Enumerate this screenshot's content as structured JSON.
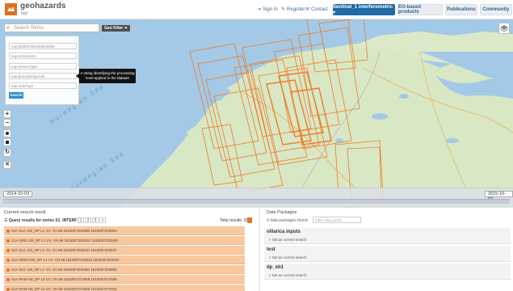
{
  "header": {
    "brand": "geohazards",
    "brand_sub": "tep",
    "sign_in": "Sign In",
    "register": "Register",
    "contact": "Contact",
    "context_button": "Sentinel_1 interferometric ▾",
    "eo_products": "EO-based products",
    "publications": "Publications",
    "community": "Community"
  },
  "search": {
    "placeholder": "Search Terms",
    "geo_filter": "Geo Filter ✕"
  },
  "filter_panel": {
    "fields": [
      "eop:platformSerialIdentifier",
      "eop:instrument",
      "eop:sensorType",
      "eop:processingLevel",
      "eop:orbitType"
    ],
    "search_button": "Search"
  },
  "tooltip": {
    "text": "A string identifying the processing level applied to the dataset"
  },
  "map": {
    "sea_labels": [
      "Norwegian Sea",
      "Norwegian Sea"
    ]
  },
  "timeline": {
    "start": "2014-10-03",
    "end": "2015-10-07"
  },
  "results": {
    "title": "Current search result",
    "query": "Query results for series S1_INTERF",
    "pages": [
      "1",
      "2",
      "3",
      "»"
    ],
    "total": "Total results: 158",
    "total_badge": "",
    "rows": [
      "S1A SLC 1W_DP L1 VV, VH 68 1515007202836 1515007202903",
      "S1A GRD 1W_DP L1 VV, VH 68 1515007202810 1515007202836",
      "S1A SLC 1W_DP L1 VV, VH 68 1515007202810 1515007202837",
      "S1A GRDH IW_DP L1 VV, VH 68 1515007202810 1515007202837",
      "S1A SLC 1W_DP L1 VV, VH 68 1515007202800 1515007202800",
      "S1A RAW IW_DP L0 VV, VH 68 1515007072605 1515007072606",
      "S1A RAW IW_DP L0 VV, VH 68 1515007072605 1515007072641",
      "S1A RAW IW_DP L0 VV, VH 68 1515007072605 1515007072641",
      "S1A GRD EW_DP L1 HH, HV 45 1515007065455 1515007065530"
    ]
  },
  "packages": {
    "title": "Data Packages",
    "count": "9 data packages found",
    "filter_placeholder": "Filter data packs",
    "items": [
      {
        "name": "villarica inputs",
        "action": "Set as current search"
      },
      {
        "name": "test",
        "action": "Set as current search"
      },
      {
        "name": "dp_eb1",
        "action": "Set as current search"
      }
    ]
  },
  "colors": {
    "accent": "#e0701e",
    "primary": "#1f6aa5",
    "footprint": "#f07a2a",
    "sea": "#a3c9e6",
    "land": "#d8e8c5"
  }
}
